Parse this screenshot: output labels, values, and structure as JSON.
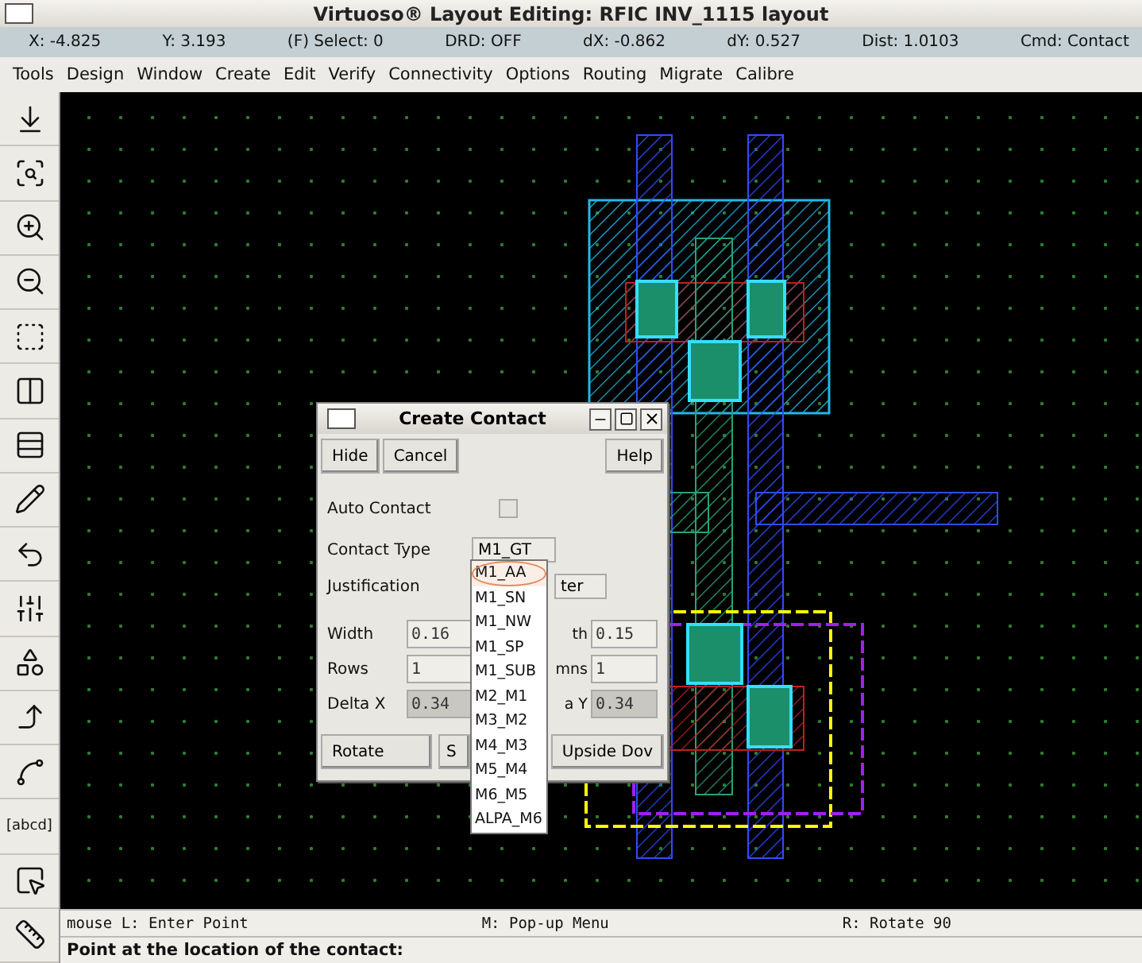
{
  "window": {
    "title": "Virtuoso® Layout Editing: RFIC INV_1115 layout"
  },
  "coords": [
    "X: -4.825",
    "Y:  3.193",
    "(F) Select: 0",
    "DRD: OFF",
    "dX: -0.862",
    "dY:  0.527",
    "Dist: 1.0103",
    "Cmd: Contact"
  ],
  "menu": [
    "Tools",
    "Design",
    "Window",
    "Create",
    "Edit",
    "Verify",
    "Connectivity",
    "Options",
    "Routing",
    "Migrate",
    "Calibre"
  ],
  "toolbar": {
    "label_tool": "[abcd]"
  },
  "dialog": {
    "title": "Create Contact",
    "top_buttons": [
      "Hide",
      "Cancel",
      "Help"
    ],
    "auto_contact": {
      "label": "Auto Contact",
      "checked": false
    },
    "contact_type": {
      "label": "Contact Type",
      "value": "M1_GT"
    },
    "justification": {
      "label": "Justification",
      "value": "ter"
    },
    "fields": [
      {
        "label": "Width",
        "value": "0.16",
        "label2": "th",
        "value2": "0.15",
        "disabled": false
      },
      {
        "label": "Rows",
        "value": "1",
        "label2": "mns",
        "value2": "1",
        "disabled": false
      },
      {
        "label": "Delta X",
        "value": "0.34",
        "label2": "a Y",
        "value2": "0.34",
        "disabled": true
      }
    ],
    "bottom_buttons": [
      "Rotate",
      "S",
      "Upside Dov"
    ],
    "dropdown": [
      {
        "label": "M1_AA",
        "selected": true
      },
      {
        "label": "M1_SN",
        "selected": false
      },
      {
        "label": "M1_NW",
        "selected": false
      },
      {
        "label": "M1_SP",
        "selected": false
      },
      {
        "label": "M1_SUB",
        "selected": false
      },
      {
        "label": "M2_M1",
        "selected": false
      },
      {
        "label": "M3_M2",
        "selected": false
      },
      {
        "label": "M4_M3",
        "selected": false
      },
      {
        "label": "M5_M4",
        "selected": false
      },
      {
        "label": "M6_M5",
        "selected": false
      },
      {
        "label": "ALPA_M6",
        "selected": false
      }
    ]
  },
  "status": {
    "mouse_left": "mouse L: Enter Point",
    "mouse_middle": "M: Pop-up Menu",
    "mouse_right": "R: Rotate 90",
    "prompt": "Point at the location of the contact:"
  }
}
